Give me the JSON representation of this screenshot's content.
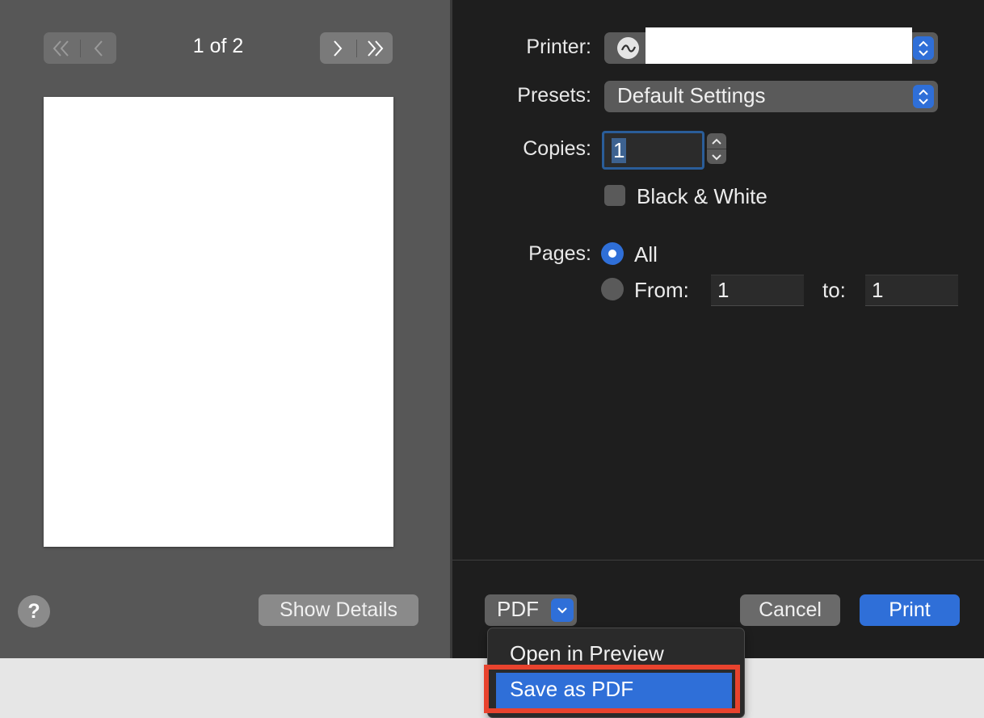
{
  "navigation": {
    "page_counter": "1 of 2",
    "first_icon": "double-chevron-left-icon",
    "prev_icon": "chevron-left-icon",
    "next_icon": "chevron-right-icon",
    "last_icon": "double-chevron-right-icon"
  },
  "left_panel": {
    "help_label": "?",
    "show_details_label": "Show Details"
  },
  "settings": {
    "printer_label": "Printer:",
    "printer_icon": "printer-network-icon",
    "printer_value": "",
    "presets_label": "Presets:",
    "presets_value": "Default Settings",
    "copies_label": "Copies:",
    "copies_value": "1",
    "black_white_label": "Black & White",
    "black_white_checked": false,
    "pages_label": "Pages:",
    "pages_all_label": "All",
    "pages_from_label": "From:",
    "pages_to_label": "to:",
    "pages_from_value": "1",
    "pages_to_value": "1",
    "pages_selected": "All"
  },
  "footer": {
    "pdf_label": "PDF",
    "cancel_label": "Cancel",
    "print_label": "Print"
  },
  "pdf_menu": {
    "items": [
      "Open in Preview",
      "Save as PDF"
    ],
    "highlighted": "Save as PDF"
  },
  "colors": {
    "accent": "#2f6fd8",
    "highlight_outline": "#e8432e",
    "panel_left": "#575757",
    "panel_right": "#1e1e1e"
  }
}
